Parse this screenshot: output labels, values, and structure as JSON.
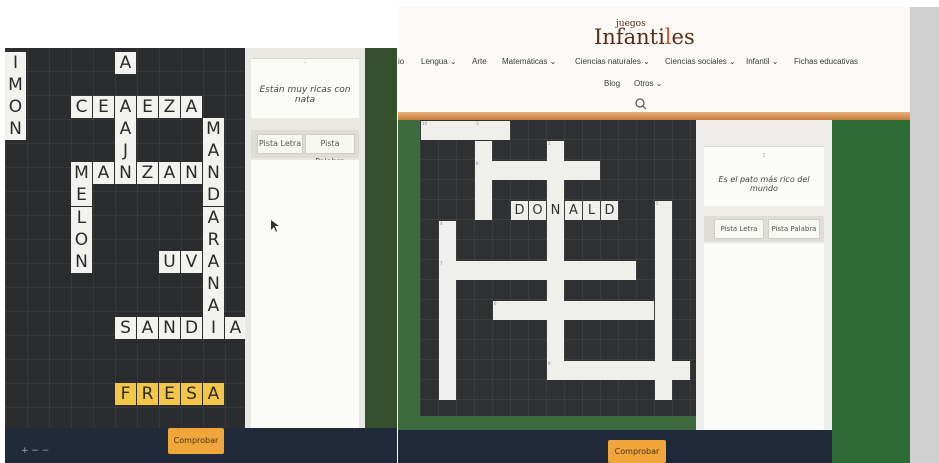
{
  "left_screen": {
    "clue_text": "Están muy ricas con nata",
    "clue_number": "-",
    "buttons": {
      "hint_letter": "Pista Letra",
      "hint_word": "Pista Palabra"
    },
    "check_button": "Comprobar",
    "zoom_controls": "+ − −",
    "words": [
      "LIMON",
      "CEREZA",
      "PAJA",
      "MANZANA",
      "MELON",
      "MANDARINA",
      "UVA",
      "SANDIA",
      "FRESA"
    ]
  },
  "right_screen": {
    "logo": {
      "top": "juegos",
      "main_a": "Infanti",
      "main_dot": "l",
      "main_b": "es"
    },
    "nav_row1": [
      "io",
      "Lengua ⌄",
      "Arte",
      "Matemáticas ⌄",
      "Ciencias naturales ⌄",
      "Ciencias sociales ⌄",
      "Infantil ⌄",
      "Fichas educativas"
    ],
    "nav_row2": [
      "Blog",
      "Otros ⌄"
    ],
    "clue_number": "1",
    "clue_text": "Es el pato más rico del mundo",
    "buttons": {
      "hint_letter": "Pista Letra",
      "hint_word": "Pista Palabra"
    },
    "check_button": "Comprobar",
    "answered_word": "DONALD",
    "cell_numbers": [
      "10",
      "3",
      "2",
      "8",
      "5",
      "4",
      "7",
      "6",
      "9"
    ]
  },
  "colors": {
    "board": "#2b2c2e",
    "cell": "#f2f2ef",
    "highlight": "#f3c648",
    "accent_button": "#f0a63a",
    "logo_brown": "#5b2b18",
    "logo_orange": "#d14f29"
  }
}
